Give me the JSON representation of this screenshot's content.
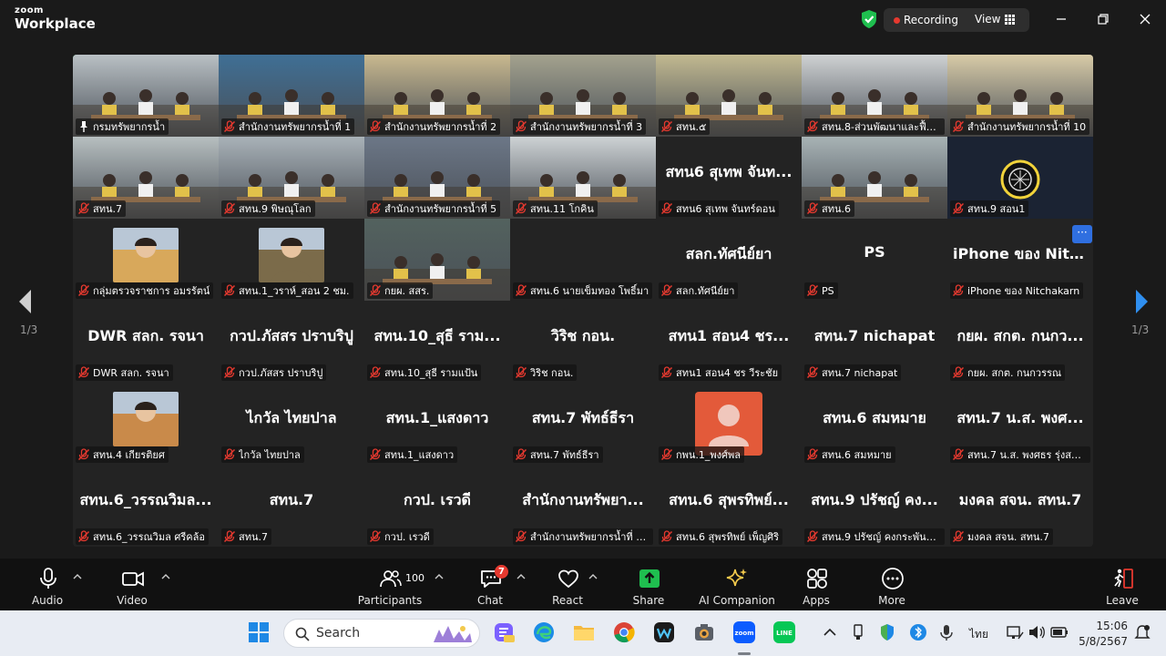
{
  "app": {
    "brand_line1": "zoom",
    "brand_line2": "Workplace",
    "recording_label": "Recording",
    "view_label": "View"
  },
  "gallery": {
    "page_left": "1/3",
    "page_right": "1/3",
    "more_label": "···",
    "tiles": [
      {
        "caption": "กรมทรัพยากรน้ำ",
        "big": "",
        "kind": "video",
        "tone": "#b9c0c4",
        "pin": true,
        "active": true
      },
      {
        "caption": "สำนักงานทรัพยากรน้ำที่ 1",
        "big": "",
        "kind": "video",
        "tone": "#3f6f95"
      },
      {
        "caption": "สำนักงานทรัพยากรน้ำที่ 2",
        "big": "",
        "kind": "video",
        "tone": "#c9b98f"
      },
      {
        "caption": "สำนักงานทรัพยากรน้ำที่ 3",
        "big": "",
        "kind": "video",
        "tone": "#a4a28e"
      },
      {
        "caption": "สทน.๕",
        "big": "",
        "kind": "video",
        "tone": "#c2b990"
      },
      {
        "caption": "สทน.8-ส่วนพัฒนาและฟื้น...",
        "big": "",
        "kind": "video",
        "tone": "#cfd2d3"
      },
      {
        "caption": "สำนักงานทรัพยากรน้ำที่ 10",
        "big": "",
        "kind": "video",
        "tone": "#d8cba7"
      },
      {
        "caption": "สทน.7",
        "big": "",
        "kind": "video",
        "tone": "#b7bfc0"
      },
      {
        "caption": "สทน.9 พิษณุโลก",
        "big": "",
        "kind": "video",
        "tone": "#a9b2b8"
      },
      {
        "caption": "สำนักงานทรัพยากรน้ำที่ 5",
        "big": "",
        "kind": "video",
        "tone": "#6c7787"
      },
      {
        "caption": "สทน.11 โกคิน",
        "big": "",
        "kind": "video",
        "tone": "#cdd2d4"
      },
      {
        "caption": "สทน6 สุเทพ จันทร์ดอน",
        "big": "สทน6 สุเทพ จันท...",
        "kind": "name"
      },
      {
        "caption": "สทน.6",
        "big": "",
        "kind": "video",
        "tone": "#a8b3b5"
      },
      {
        "caption": "สทน.9 สอน1",
        "big": "",
        "kind": "logo"
      },
      {
        "caption": "กลุ่มตรวจราชการ อมรรัตน์",
        "big": "",
        "kind": "avatar",
        "tone": "#d8a85b"
      },
      {
        "caption": "สทน.1_วราห์_สอน 2 ชม.",
        "big": "",
        "kind": "avatar",
        "tone": "#7b6b4a"
      },
      {
        "caption": "กยผ. สสร.",
        "big": "",
        "kind": "video",
        "tone": "#53625e"
      },
      {
        "caption": "สทน.6 นายเข็มทอง โพธิ์มา",
        "big": "",
        "kind": "name"
      },
      {
        "caption": "สลก.ทัศนีย์ยา",
        "big": "สลก.ทัศนีย์ยา",
        "kind": "name"
      },
      {
        "caption": "PS",
        "big": "PS",
        "kind": "name"
      },
      {
        "caption": "iPhone ของ Nitchakarn",
        "big": "iPhone ของ Nitc...",
        "kind": "name"
      },
      {
        "caption": "DWR สลก. รจนา",
        "big": "DWR สลก. รจนา",
        "kind": "name"
      },
      {
        "caption": "กวป.ภัสสร ปราบริปู",
        "big": "กวป.ภัสสร ปราบริปู",
        "kind": "name"
      },
      {
        "caption": "สทน.10_สุธี รามแป้น",
        "big": "สทน.10_สุธี ราม...",
        "kind": "name"
      },
      {
        "caption": "วิริช กอน.",
        "big": "วิริช กอน.",
        "kind": "name"
      },
      {
        "caption": "สทน1 สอน4 ชร วีระชัย",
        "big": "สทน1 สอน4 ชร...",
        "kind": "name"
      },
      {
        "caption": "สทน.7 nichapat",
        "big": "สทน.7 nichapat",
        "kind": "name"
      },
      {
        "caption": "กยผ. สกต. กนกวรรณ",
        "big": "กยผ. สกต. กนกว...",
        "kind": "name"
      },
      {
        "caption": "สทน.4 เกียรติยศ",
        "big": "",
        "kind": "avatar",
        "tone": "#c98a4a"
      },
      {
        "caption": "ไกวัล ไทยปาล",
        "big": "ไกวัล ไทยปาล",
        "kind": "name"
      },
      {
        "caption": "สทน.1_แสงดาว",
        "big": "สทน.1_แสงดาว",
        "kind": "name"
      },
      {
        "caption": "สทน.7 พัทธ์ธีรา",
        "big": "สทน.7 พัทธ์ธีรา",
        "kind": "name"
      },
      {
        "caption": "กพน.1_พงศ์พล",
        "big": "",
        "kind": "default"
      },
      {
        "caption": "สทน.6 สมหมาย",
        "big": "สทน.6 สมหมาย",
        "kind": "name"
      },
      {
        "caption": "สทน.7 น.ส. พงศธร รุ่งสมัย ...",
        "big": "สทน.7 น.ส. พงศ...",
        "kind": "name"
      },
      {
        "caption": "สทน.6_วรรณวิมล ศรีคล้อ",
        "big": "สทน.6_วรรณวิมล...",
        "kind": "name"
      },
      {
        "caption": "สทน.7",
        "big": "สทน.7",
        "kind": "name"
      },
      {
        "caption": "กวป. เรวดี",
        "big": "กวป. เรวดี",
        "kind": "name"
      },
      {
        "caption": "สำนักงานทรัพยากรน้ำที่ 1...",
        "big": "สำนักงานทรัพยา...",
        "kind": "name"
      },
      {
        "caption": "สทน.6 สุพรทิพย์ เพ็ญศิริ",
        "big": "สทน.6 สุพรทิพย์...",
        "kind": "name"
      },
      {
        "caption": "สทน.9 ปรัชญ์ คงกระพันธ์ (...",
        "big": "สทน.9 ปรัชญ์ คง...",
        "kind": "name"
      },
      {
        "caption": "มงคล สจน. สทน.7",
        "big": "มงคล สจน. สทน.7",
        "kind": "name"
      }
    ]
  },
  "toolbar": {
    "audio": "Audio",
    "video": "Video",
    "participants": "Participants",
    "participant_count": "100",
    "chat": "Chat",
    "chat_badge": "7",
    "react": "React",
    "share": "Share",
    "ai_companion": "AI Companion",
    "apps": "Apps",
    "more": "More",
    "leave": "Leave"
  },
  "taskbar": {
    "search_label": "Search",
    "language": "ไทย",
    "time": "15:06",
    "date": "5/8/2567"
  },
  "colors": {
    "accent_green": "#1fbf4f",
    "recording_red": "#e5392f",
    "mic_muted_red": "#e5392f",
    "leave_red": "#e5392f"
  }
}
